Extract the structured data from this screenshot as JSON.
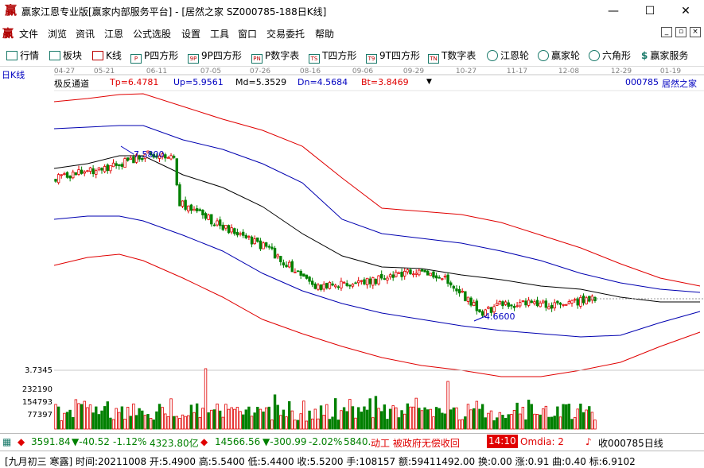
{
  "window": {
    "title": "赢家江恩专业版[赢家内部服务平台] - [居然之家  SZ000785-188日K线]",
    "logo_glyph": "赢",
    "minimize_glyph": "—",
    "maximize_glyph": "☐",
    "close_glyph": "✕"
  },
  "menu": {
    "items": [
      "文件",
      "浏览",
      "资讯",
      "江恩",
      "公式选股",
      "设置",
      "工具",
      "窗口",
      "交易委托",
      "帮助"
    ],
    "mdi_buttons": [
      "_",
      "▫",
      "×"
    ]
  },
  "toolbar": {
    "items": [
      {
        "label": "行情",
        "icon": "grid-icon"
      },
      {
        "label": "板块",
        "icon": "blocks-icon"
      },
      {
        "label": "K线",
        "icon": "kline-icon"
      },
      {
        "label": "P四方形",
        "icon": "P"
      },
      {
        "label": "9P四方形",
        "icon": "9P"
      },
      {
        "label": "P数字表",
        "icon": "PN"
      },
      {
        "label": "T四方形",
        "icon": "TS"
      },
      {
        "label": "9T四方形",
        "icon": "T9"
      },
      {
        "label": "T数字表",
        "icon": "TN"
      },
      {
        "label": "江恩轮",
        "icon": "wheel-icon"
      },
      {
        "label": "赢家轮",
        "icon": "wheel2-icon"
      },
      {
        "label": "六角形",
        "icon": "hexagon-icon"
      },
      {
        "label": "赢家服务",
        "icon": "dollar-icon"
      }
    ]
  },
  "chart_header": {
    "period_label": "日K线",
    "indicator_name": "极反通道",
    "tp": "Tp=6.4781",
    "up": "Up=5.9561",
    "md": "Md=5.3529",
    "dn": "Dn=4.5684",
    "bt": "Bt=3.8469",
    "stock_code": "000785",
    "stock_name": "居然之家"
  },
  "chart_data": {
    "type": "line",
    "x_date_labels": [
      "04-27",
      "05-21",
      "06-11",
      "07-05",
      "07-26",
      "08-16",
      "09-06",
      "09-29",
      "10-27",
      "11-17",
      "12-08",
      "12-29",
      "01-19"
    ],
    "annotations": [
      {
        "label": "7.5800",
        "kind": "high"
      },
      {
        "label": "4.6600",
        "kind": "low"
      }
    ],
    "volume_axis_labels": [
      "3.7345",
      "232190",
      "154793",
      "77397"
    ],
    "candle_count": 188,
    "ohlc_start": 7.0,
    "ohlc_end": 5.52,
    "colors": {
      "up": "#e00000",
      "down": "#008000",
      "upper_band": "#e00000",
      "mid_band": "#0000b0",
      "median": "#000000"
    }
  },
  "status1": {
    "index1_value": "3591.84",
    "index1_change": "▼-40.52",
    "index1_pct": "-1.12%",
    "index1_amount": "4323.80亿",
    "index2_value": "14566.56",
    "index2_change": "▼-300.99",
    "index2_pct": "-2.02%",
    "index2_amount": "5840.",
    "news": "动工  被政府无偿收回",
    "time": "14:10",
    "omdia": "Omdia: 2",
    "right_text": "收000785日线"
  },
  "status2": {
    "text": "[九月初三 寒露] 时间:20211008 开:5.4900 高:5.5400 低:5.4400 收:5.5200 手:108157 额:59411492.00 换:0.00 涨:0.91 曲:0.40 标:6.9102"
  }
}
